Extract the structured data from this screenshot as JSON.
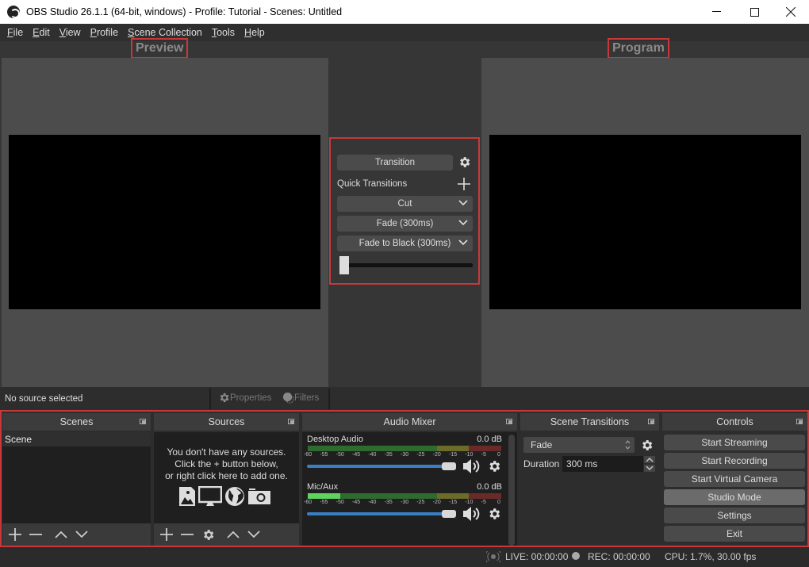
{
  "window": {
    "title": "OBS Studio 26.1.1 (64-bit, windows) - Profile: Tutorial - Scenes: Untitled",
    "minimize_icon": "minimize-icon",
    "maximize_icon": "maximize-icon",
    "close_icon": "close-icon"
  },
  "menu": [
    "File",
    "Edit",
    "View",
    "Profile",
    "Scene Collection",
    "Tools",
    "Help"
  ],
  "preview": {
    "label": "Preview"
  },
  "program": {
    "label": "Program"
  },
  "transition_panel": {
    "transition_label": "Transition",
    "quick_transitions_label": "Quick Transitions",
    "quick": [
      "Cut",
      "Fade (300ms)",
      "Fade to Black (300ms)"
    ],
    "tbar_position": 0
  },
  "source_status": {
    "text": "No source selected",
    "properties_label": "Properties",
    "filters_label": "Filters"
  },
  "docks": {
    "scenes": {
      "title": "Scenes",
      "items": [
        "Scene"
      ]
    },
    "sources": {
      "title": "Sources",
      "empty_lines": [
        "You don't have any sources.",
        "Click the + button below,",
        "or right click here to add one."
      ]
    },
    "audio_mixer": {
      "title": "Audio Mixer",
      "scale": [
        "-60",
        "-55",
        "-50",
        "-45",
        "-40",
        "-35",
        "-30",
        "-25",
        "-20",
        "-15",
        "-10",
        "-5",
        "0"
      ],
      "channels": [
        {
          "name": "Desktop Audio",
          "db": "0.0 dB",
          "volume": 1.0,
          "level": 0.0
        },
        {
          "name": "Mic/Aux",
          "db": "0.0 dB",
          "volume": 1.0,
          "level": 0.17
        }
      ]
    },
    "scene_transitions": {
      "title": "Scene Transitions",
      "selected": "Fade",
      "duration_label": "Duration",
      "duration_value": "300 ms"
    },
    "controls": {
      "title": "Controls",
      "buttons": [
        "Start Streaming",
        "Start Recording",
        "Start Virtual Camera",
        "Studio Mode",
        "Settings",
        "Exit"
      ]
    }
  },
  "statusbar": {
    "live": "LIVE: 00:00:00",
    "rec": "REC: 00:00:00",
    "cpu": "CPU: 1.7%, 30.00 fps"
  },
  "colors": {
    "highlight_border": "#c8383b",
    "volume_blue": "#3a7fc4",
    "meter_green": "#4caf50",
    "meter_yellow": "#9a9a3a",
    "meter_red": "#8a3030"
  }
}
